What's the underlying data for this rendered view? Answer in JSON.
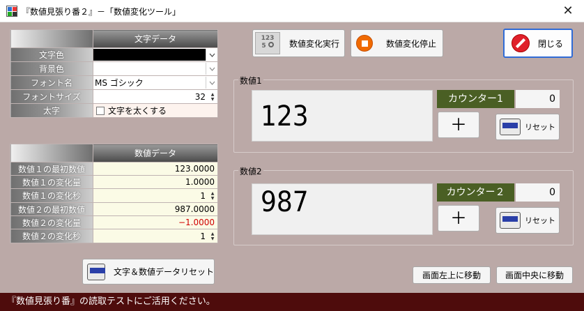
{
  "window": {
    "title": "『数値見張り番２』－「数値変化ツール」",
    "close_glyph": "✕"
  },
  "text_data_grid": {
    "header": "文字データ",
    "rows": [
      {
        "label": "文字色",
        "value": ""
      },
      {
        "label": "背景色",
        "value": ""
      },
      {
        "label": "フォント名",
        "value": "MS ゴシック"
      },
      {
        "label": "フォントサイズ",
        "value": "32"
      },
      {
        "label": "太字",
        "value": "文字を太くする"
      }
    ],
    "text_color": "#000000"
  },
  "numeric_data_grid": {
    "header": "数値データ",
    "rows": [
      {
        "label": "数値１の最初数値",
        "value": "123.0000"
      },
      {
        "label": "数値１の変化量",
        "value": "1.0000"
      },
      {
        "label": "数値１の変化秒",
        "value": "1"
      },
      {
        "label": "数値２の最初数値",
        "value": "987.0000"
      },
      {
        "label": "数値２の変化量",
        "value": "−1.0000"
      },
      {
        "label": "数値２の変化秒",
        "value": "1"
      }
    ]
  },
  "toolbar": {
    "start_label": "数値変化実行",
    "stop_label": "数値変化停止",
    "close_label": "閉じる"
  },
  "group1": {
    "label": "数値1",
    "value": "123",
    "counter_label": "カウンター1",
    "counter_value": "0",
    "plus": "＋",
    "reset_label": "リセット"
  },
  "group2": {
    "label": "数値2",
    "value": "987",
    "counter_label": "カウンター２",
    "counter_value": "0",
    "plus": "＋",
    "reset_label": "リセット"
  },
  "bottom": {
    "reset_all_label": "文字＆数値データリセット",
    "move_topleft_label": "画面左上に移動",
    "move_center_label": "画面中央に移動"
  },
  "status": {
    "text": "『数値見張り番』の読取テストにご活用ください。"
  },
  "colors": {
    "client_bg": "#bba9a7",
    "status_bg": "#4e0c0c",
    "counter_bg": "#4a5f24",
    "negative": "#d00000"
  }
}
